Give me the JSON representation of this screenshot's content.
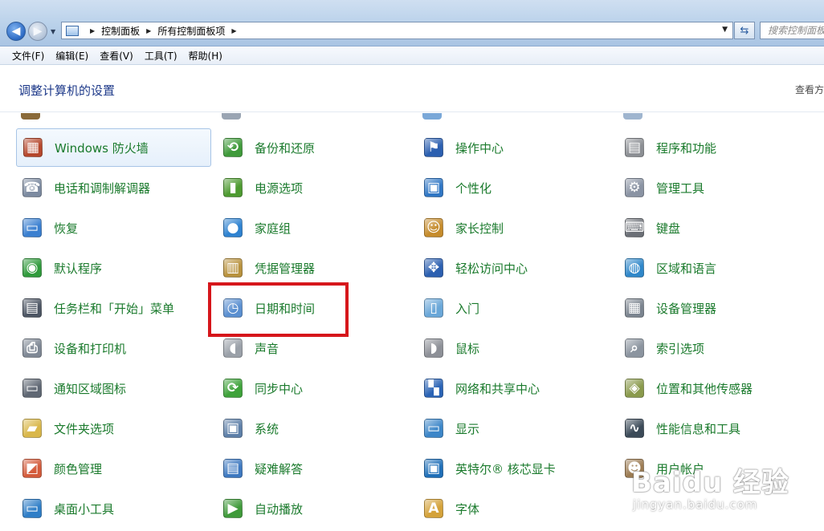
{
  "address_bar": {
    "breadcrumbs": [
      "控制面板",
      "所有控制面板项"
    ],
    "search_placeholder": "搜索控制面板"
  },
  "menu": [
    "文件(F)",
    "编辑(E)",
    "查看(V)",
    "工具(T)",
    "帮助(H)"
  ],
  "header": {
    "title": "调整计算机的设置",
    "view_by": "查看方"
  },
  "items": [
    {
      "label": "Windows 防火墙",
      "icon": "firewall-icon",
      "color": "#b5472c",
      "glyph": "▦"
    },
    {
      "label": "备份和还原",
      "icon": "backup-icon",
      "color": "#3f9a3a",
      "glyph": "⟲"
    },
    {
      "label": "操作中心",
      "icon": "action-center-flag-icon",
      "color": "#2b5fb0",
      "glyph": "⚑"
    },
    {
      "label": "程序和功能",
      "icon": "programs-icon",
      "color": "#8c8f94",
      "glyph": "▤"
    },
    {
      "label": "电话和调制解调器",
      "icon": "phone-modem-icon",
      "color": "#7c8aa0",
      "glyph": "☎"
    },
    {
      "label": "电源选项",
      "icon": "power-icon",
      "color": "#4d9a30",
      "glyph": "▮"
    },
    {
      "label": "个性化",
      "icon": "personalization-icon",
      "color": "#2f76c4",
      "glyph": "▣"
    },
    {
      "label": "管理工具",
      "icon": "admin-tools-icon",
      "color": "#8a93a3",
      "glyph": "⚙"
    },
    {
      "label": "恢复",
      "icon": "recovery-icon",
      "color": "#3a7fd0",
      "glyph": "▭"
    },
    {
      "label": "家庭组",
      "icon": "homegroup-icon",
      "color": "#2e82d0",
      "glyph": "●"
    },
    {
      "label": "家长控制",
      "icon": "parental-controls-icon",
      "color": "#c58b2b",
      "glyph": "☺"
    },
    {
      "label": "键盘",
      "icon": "keyboard-icon",
      "color": "#6b6f76",
      "glyph": "⌨"
    },
    {
      "label": "默认程序",
      "icon": "default-programs-icon",
      "color": "#2f9a3b",
      "glyph": "◉"
    },
    {
      "label": "凭据管理器",
      "icon": "credential-manager-icon",
      "color": "#b8913c",
      "glyph": "▥"
    },
    {
      "label": "轻松访问中心",
      "icon": "ease-of-access-icon",
      "color": "#2b5fb0",
      "glyph": "✥"
    },
    {
      "label": "区域和语言",
      "icon": "region-language-icon",
      "color": "#2f87c9",
      "glyph": "◍"
    },
    {
      "label": "任务栏和「开始」菜单",
      "icon": "taskbar-icon",
      "color": "#4c5563",
      "glyph": "▤"
    },
    {
      "label": "日期和时间",
      "icon": "date-time-icon",
      "color": "#5a8fd0",
      "glyph": "◷"
    },
    {
      "label": "入门",
      "icon": "getting-started-icon",
      "color": "#6aa7d8",
      "glyph": "▯"
    },
    {
      "label": "设备管理器",
      "icon": "device-manager-icon",
      "color": "#7b848f",
      "glyph": "▦"
    },
    {
      "label": "设备和打印机",
      "icon": "printer-icon",
      "color": "#7e8794",
      "glyph": "⎙"
    },
    {
      "label": "声音",
      "icon": "speaker-icon",
      "color": "#9aa0a8",
      "glyph": "◖"
    },
    {
      "label": "鼠标",
      "icon": "mouse-icon",
      "color": "#8d9097",
      "glyph": "◗"
    },
    {
      "label": "索引选项",
      "icon": "indexing-icon",
      "color": "#8b949f",
      "glyph": "⌕"
    },
    {
      "label": "通知区域图标",
      "icon": "notification-area-icon",
      "color": "#5f6773",
      "glyph": "▭"
    },
    {
      "label": "同步中心",
      "icon": "sync-center-icon",
      "color": "#3ea23a",
      "glyph": "⟳"
    },
    {
      "label": "网络和共享中心",
      "icon": "network-icon",
      "color": "#2a63b5",
      "glyph": "▚"
    },
    {
      "label": "位置和其他传感器",
      "icon": "location-sensor-icon",
      "color": "#8a9a4c",
      "glyph": "◈"
    },
    {
      "label": "文件夹选项",
      "icon": "folder-options-icon",
      "color": "#d9b74a",
      "glyph": "▰"
    },
    {
      "label": "系统",
      "icon": "system-icon",
      "color": "#5d7fa8",
      "glyph": "▣"
    },
    {
      "label": "显示",
      "icon": "display-icon",
      "color": "#3c86c8",
      "glyph": "▭"
    },
    {
      "label": "性能信息和工具",
      "icon": "performance-icon",
      "color": "#3b4a58",
      "glyph": "∿"
    },
    {
      "label": "颜色管理",
      "icon": "color-management-icon",
      "color": "#d45b3b",
      "glyph": "◩"
    },
    {
      "label": "疑难解答",
      "icon": "troubleshooting-icon",
      "color": "#3d78c0",
      "glyph": "▤"
    },
    {
      "label": "英特尔® 核芯显卡",
      "icon": "intel-graphics-icon",
      "color": "#1f6fb8",
      "glyph": "▣"
    },
    {
      "label": "用户帐户",
      "icon": "user-accounts-icon",
      "color": "#9c7b52",
      "glyph": "☻"
    },
    {
      "label": "桌面小工具",
      "icon": "desktop-gadgets-icon",
      "color": "#2f7ec7",
      "glyph": "▭"
    },
    {
      "label": "自动播放",
      "icon": "autoplay-icon",
      "color": "#3f9a3a",
      "glyph": "▶"
    },
    {
      "label": "字体",
      "icon": "fonts-icon",
      "color": "#d4a23a",
      "glyph": "A"
    }
  ],
  "watermark": {
    "logo": "Baidu 经验",
    "url": "jingyan.baidu.com"
  }
}
